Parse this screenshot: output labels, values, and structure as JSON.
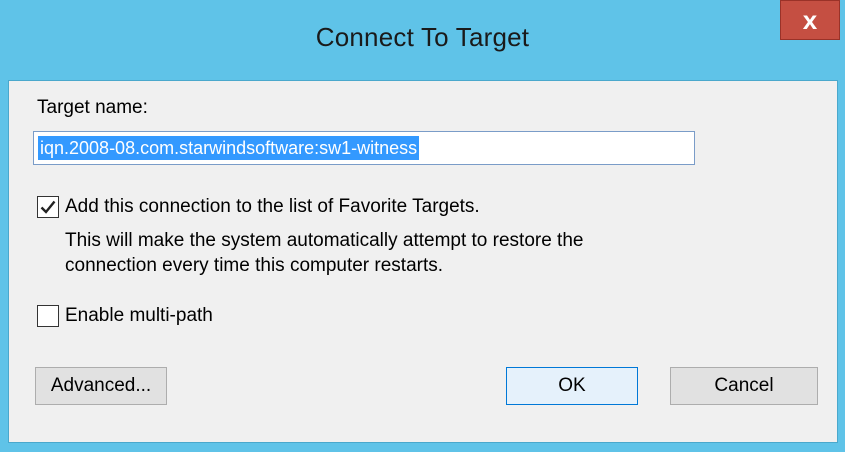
{
  "window": {
    "title": "Connect To Target",
    "close_glyph": "x"
  },
  "form": {
    "target_name_label": "Target name:",
    "target_name_value": "iqn.2008-08.com.starwindsoftware:sw1-witness",
    "favorite_checkbox": {
      "checked": true,
      "label": "Add this connection to the list of Favorite Targets.",
      "description_line1": "This will make the system automatically attempt to restore the",
      "description_line2": "connection every time this computer restarts."
    },
    "multipath_checkbox": {
      "checked": false,
      "label": "Enable multi-path"
    }
  },
  "buttons": {
    "advanced": "Advanced...",
    "ok": "OK",
    "cancel": "Cancel"
  },
  "colors": {
    "titlebar": "#5fc3e8",
    "close_button": "#c54f42",
    "selection": "#3399ff",
    "dialog_background": "#f0f0f0"
  }
}
